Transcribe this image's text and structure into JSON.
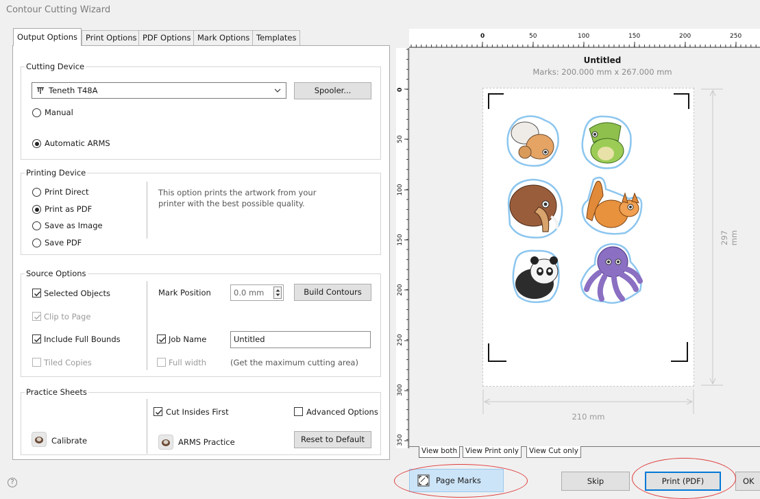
{
  "window": {
    "title": "Contour Cutting Wizard"
  },
  "tabs": [
    "Output Options",
    "Print Options",
    "PDF Options",
    "Mark Options",
    "Templates"
  ],
  "cutting_device": {
    "title": "Cutting Device",
    "device": "Teneth T48A",
    "spooler_label": "Spooler...",
    "manual_label": "Manual",
    "manual_checked": false,
    "arms_label": "Automatic ARMS",
    "arms_checked": true
  },
  "printing_device": {
    "title": "Printing Device",
    "options": [
      "Print Direct",
      "Print as PDF",
      "Save as Image",
      "Save PDF"
    ],
    "selected": "Print as PDF",
    "description": "This option prints the artwork from your printer with the best possible quality."
  },
  "source_options": {
    "title": "Source Options",
    "selected_objects": "Selected Objects",
    "clip_to_page": "Clip to Page",
    "include_full_bounds": "Include Full Bounds",
    "tiled_copies": "Tiled Copies",
    "mark_position_label": "Mark Position",
    "mark_position_value": "0.0 mm",
    "build_contours_label": "Build Contours",
    "job_name_label": "Job Name",
    "job_name_value": "Untitled",
    "full_width_label": "Full width",
    "full_width_hint": "(Get the maximum cutting area)"
  },
  "practice_sheets": {
    "title": "Practice Sheets",
    "calibrate_label": "Calibrate",
    "cut_insides_first": "Cut Insides First",
    "advanced_options": "Advanced Options",
    "arms_practice": "ARMS Practice",
    "reset_label": "Reset to Default"
  },
  "preview": {
    "doc_title": "Untitled",
    "marks": "Marks: 200.000 mm x 267.000 mm",
    "width_label": "210 mm",
    "height_label": "297 mm",
    "ruler_x": [
      "0",
      "50",
      "100",
      "150",
      "200",
      "250"
    ],
    "ruler_y": [
      "0",
      "50",
      "100",
      "150",
      "200",
      "250",
      "300",
      "350"
    ],
    "view_tabs": [
      "View both",
      "View Print only",
      "View Cut only"
    ],
    "active_view_tab": "View both"
  },
  "footer": {
    "help_icon": "?",
    "page_marks_label": "Page Marks",
    "skip_label": "Skip",
    "print_label": "Print (PDF)",
    "ok_label": "OK"
  },
  "colors": {
    "accent": "#0078d7",
    "highlight": "#cce4f7",
    "annotation": "#e03c3c"
  }
}
